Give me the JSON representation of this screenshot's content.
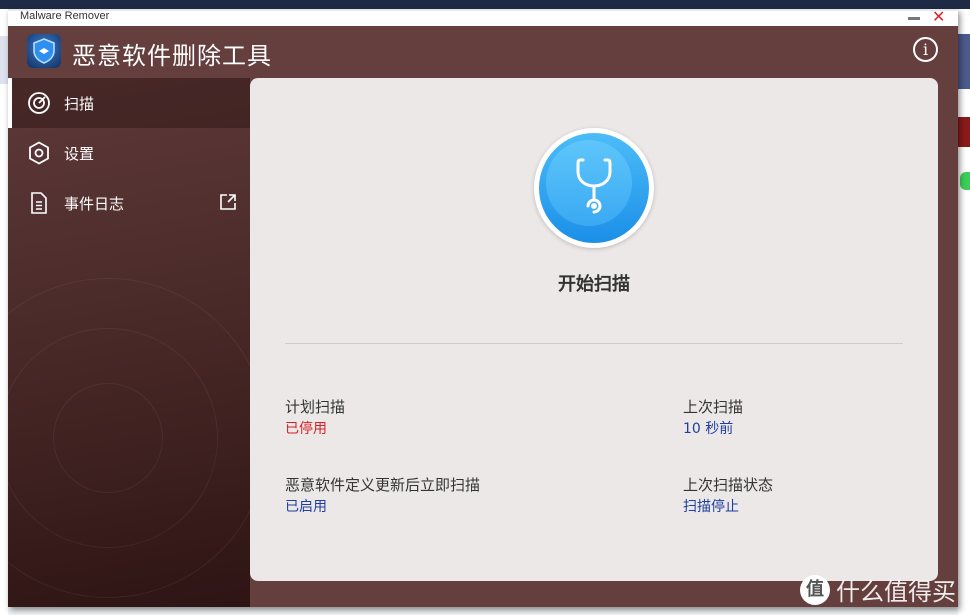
{
  "window": {
    "title": "Malware Remover",
    "minimize_icon": "minimize-icon",
    "close_icon": "close-icon"
  },
  "header": {
    "app_title": "恶意软件删除工具",
    "info_icon": "i"
  },
  "sidebar": {
    "items": [
      {
        "label": "扫描",
        "icon": "radar-icon",
        "active": true
      },
      {
        "label": "设置",
        "icon": "gear-icon"
      },
      {
        "label": "事件日志",
        "icon": "document-icon",
        "external": true
      }
    ]
  },
  "main": {
    "scan_button_label": "开始扫描",
    "scheduled_scan": {
      "label": "计划扫描",
      "value": "已停用"
    },
    "scan_after_update": {
      "label": "恶意软件定义更新后立即扫描",
      "value": "已启用"
    },
    "last_scan": {
      "label": "上次扫描",
      "value": "10 秒前"
    },
    "last_scan_status": {
      "label": "上次扫描状态",
      "value": "扫描停止"
    }
  },
  "colors": {
    "header": "#643f3e",
    "disabled": "#d61f26",
    "enabled": "#1f3fa0",
    "scan_blue": "#2a9cf0"
  },
  "watermark": {
    "glyph": "值",
    "text": "什么值得买"
  }
}
